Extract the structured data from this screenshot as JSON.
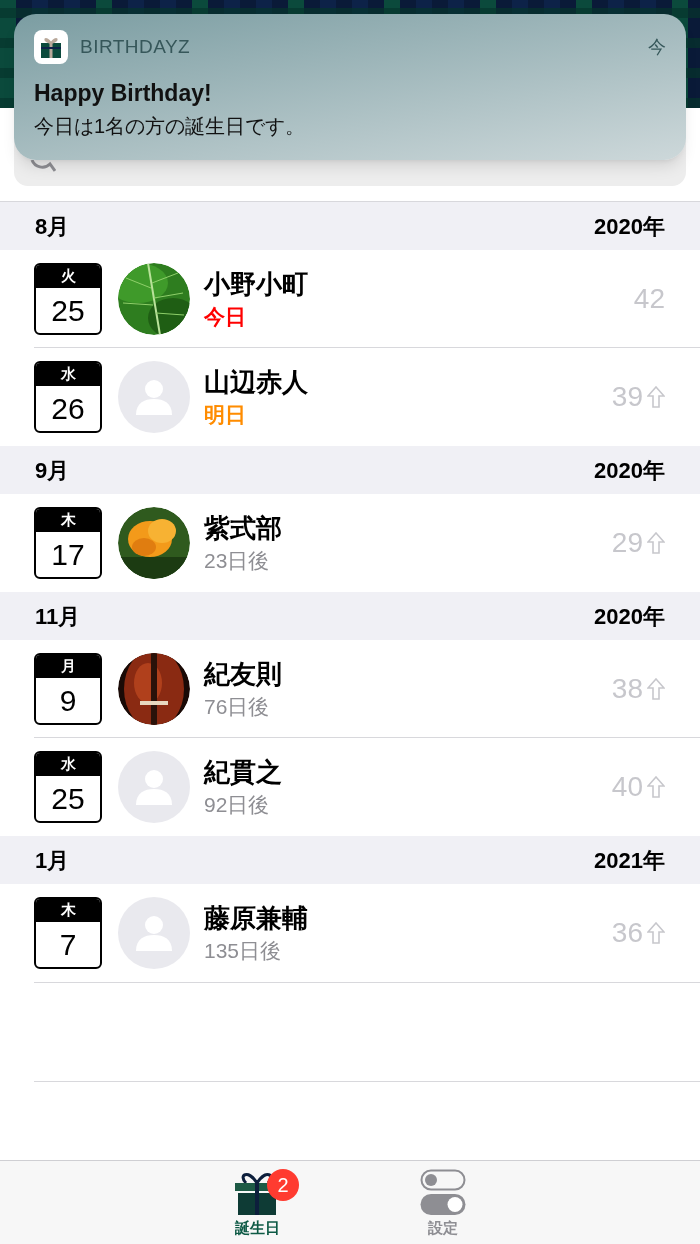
{
  "notification": {
    "app": "BIRTHDAYZ",
    "time": "今",
    "title": "Happy Birthday!",
    "body": "今日は1名の方の誕生日です。"
  },
  "sections": [
    {
      "month": "8月",
      "year": "2020年",
      "rows": [
        {
          "weekday": "火",
          "day": "25",
          "name": "小野小町",
          "status": "今日",
          "kind": "today",
          "age": "42",
          "arrow": false
        },
        {
          "weekday": "水",
          "day": "26",
          "name": "山辺赤人",
          "status": "明日",
          "kind": "tomorrow",
          "avatar": {
            "kind": "placeholder"
          },
          "age": "39",
          "arrow": true
        }
      ]
    },
    {
      "month": "9月",
      "year": "2020年",
      "rows": [
        {
          "weekday": "木",
          "day": "17",
          "name": "紫式部",
          "status": "23日後",
          "kind": "later",
          "age": "29",
          "arrow": true
        }
      ]
    },
    {
      "month": "11月",
      "year": "2020年",
      "rows": [
        {
          "weekday": "月",
          "day": "9",
          "name": "紀友則",
          "status": "76日後",
          "kind": "later",
          "age": "38",
          "arrow": true
        },
        {
          "weekday": "水",
          "day": "25",
          "name": "紀貫之",
          "status": "92日後",
          "kind": "later",
          "avatar": {
            "kind": "placeholder"
          },
          "age": "40",
          "arrow": true
        }
      ]
    },
    {
      "month": "1月",
      "year": "2021年",
      "rows": [
        {
          "weekday": "木",
          "day": "7",
          "name": "藤原兼輔",
          "status": "135日後",
          "kind": "later",
          "avatar": {
            "kind": "placeholder"
          },
          "age": "36",
          "arrow": true
        }
      ]
    }
  ],
  "tabs": [
    {
      "label": "誕生日",
      "kind": "birthdays",
      "selected": true,
      "badge": "2"
    },
    {
      "label": "設定",
      "kind": "settings",
      "selected": false
    }
  ]
}
